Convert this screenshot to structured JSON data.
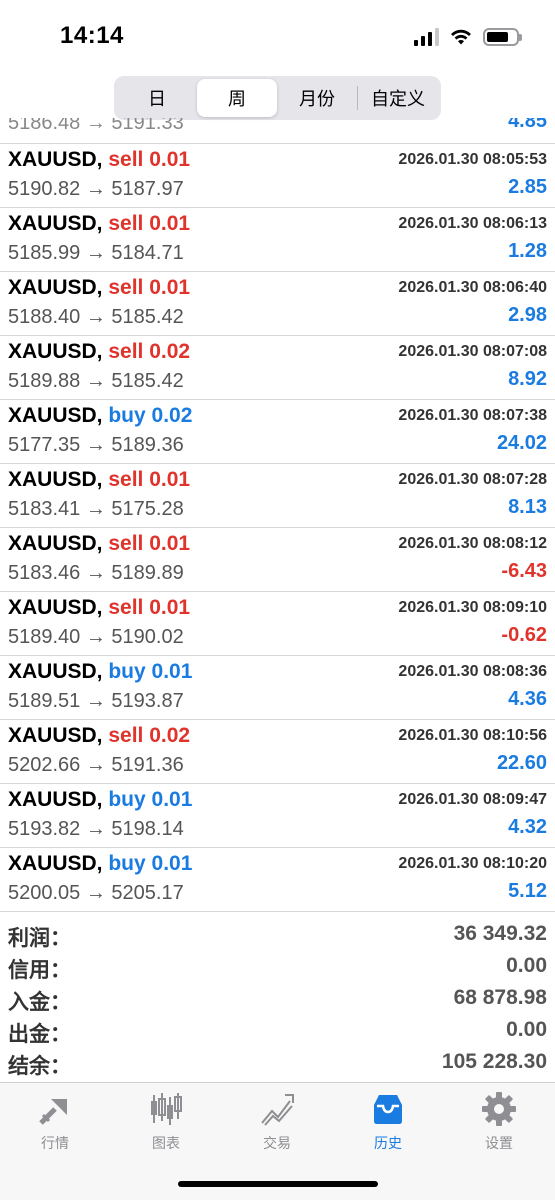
{
  "status": {
    "time": "14:14"
  },
  "colors": {
    "sell": "#e0332b",
    "buy": "#1a7be0",
    "profit_pos": "#1a7be0",
    "profit_neg": "#e0332b"
  },
  "periods": [
    {
      "label": "日",
      "active": false
    },
    {
      "label": "周",
      "active": true
    },
    {
      "label": "月份",
      "active": false
    },
    {
      "label": "自定义",
      "active": false
    }
  ],
  "partial_top_row": {
    "prices": "5186.48 → 5191.33",
    "profit": "4.85"
  },
  "deals": [
    {
      "symbol": "XAUUSD,",
      "side": "sell",
      "volume": "0.01",
      "time": "2026.01.30 08:05:53",
      "prices": "5190.82 → 5187.97",
      "profit": "2.85"
    },
    {
      "symbol": "XAUUSD,",
      "side": "sell",
      "volume": "0.01",
      "time": "2026.01.30 08:06:13",
      "prices": "5185.99 → 5184.71",
      "profit": "1.28"
    },
    {
      "symbol": "XAUUSD,",
      "side": "sell",
      "volume": "0.01",
      "time": "2026.01.30 08:06:40",
      "prices": "5188.40 → 5185.42",
      "profit": "2.98"
    },
    {
      "symbol": "XAUUSD,",
      "side": "sell",
      "volume": "0.02",
      "time": "2026.01.30 08:07:08",
      "prices": "5189.88 → 5185.42",
      "profit": "8.92"
    },
    {
      "symbol": "XAUUSD,",
      "side": "buy",
      "volume": "0.02",
      "time": "2026.01.30 08:07:38",
      "prices": "5177.35 → 5189.36",
      "profit": "24.02"
    },
    {
      "symbol": "XAUUSD,",
      "side": "sell",
      "volume": "0.01",
      "time": "2026.01.30 08:07:28",
      "prices": "5183.41 → 5175.28",
      "profit": "8.13"
    },
    {
      "symbol": "XAUUSD,",
      "side": "sell",
      "volume": "0.01",
      "time": "2026.01.30 08:08:12",
      "prices": "5183.46 → 5189.89",
      "profit": "-6.43"
    },
    {
      "symbol": "XAUUSD,",
      "side": "sell",
      "volume": "0.01",
      "time": "2026.01.30 08:09:10",
      "prices": "5189.40 → 5190.02",
      "profit": "-0.62"
    },
    {
      "symbol": "XAUUSD,",
      "side": "buy",
      "volume": "0.01",
      "time": "2026.01.30 08:08:36",
      "prices": "5189.51 → 5193.87",
      "profit": "4.36"
    },
    {
      "symbol": "XAUUSD,",
      "side": "sell",
      "volume": "0.02",
      "time": "2026.01.30 08:10:56",
      "prices": "5202.66 → 5191.36",
      "profit": "22.60"
    },
    {
      "symbol": "XAUUSD,",
      "side": "buy",
      "volume": "0.01",
      "time": "2026.01.30 08:09:47",
      "prices": "5193.82 → 5198.14",
      "profit": "4.32"
    },
    {
      "symbol": "XAUUSD,",
      "side": "buy",
      "volume": "0.01",
      "time": "2026.01.30 08:10:20",
      "prices": "5200.05 → 5205.17",
      "profit": "5.12"
    }
  ],
  "summary": [
    {
      "label": "利润：",
      "value": "36 349.32"
    },
    {
      "label": "信用：",
      "value": "0.00"
    },
    {
      "label": "入金：",
      "value": "68 878.98"
    },
    {
      "label": "出金：",
      "value": "0.00"
    },
    {
      "label": "结余：",
      "value": "105 228.30"
    }
  ],
  "tabs": [
    {
      "label": "行情",
      "icon": "quotes-icon",
      "active": false
    },
    {
      "label": "图表",
      "icon": "chart-icon",
      "active": false
    },
    {
      "label": "交易",
      "icon": "trade-icon",
      "active": false
    },
    {
      "label": "历史",
      "icon": "history-icon",
      "active": true
    },
    {
      "label": "设置",
      "icon": "settings-icon",
      "active": false
    }
  ]
}
